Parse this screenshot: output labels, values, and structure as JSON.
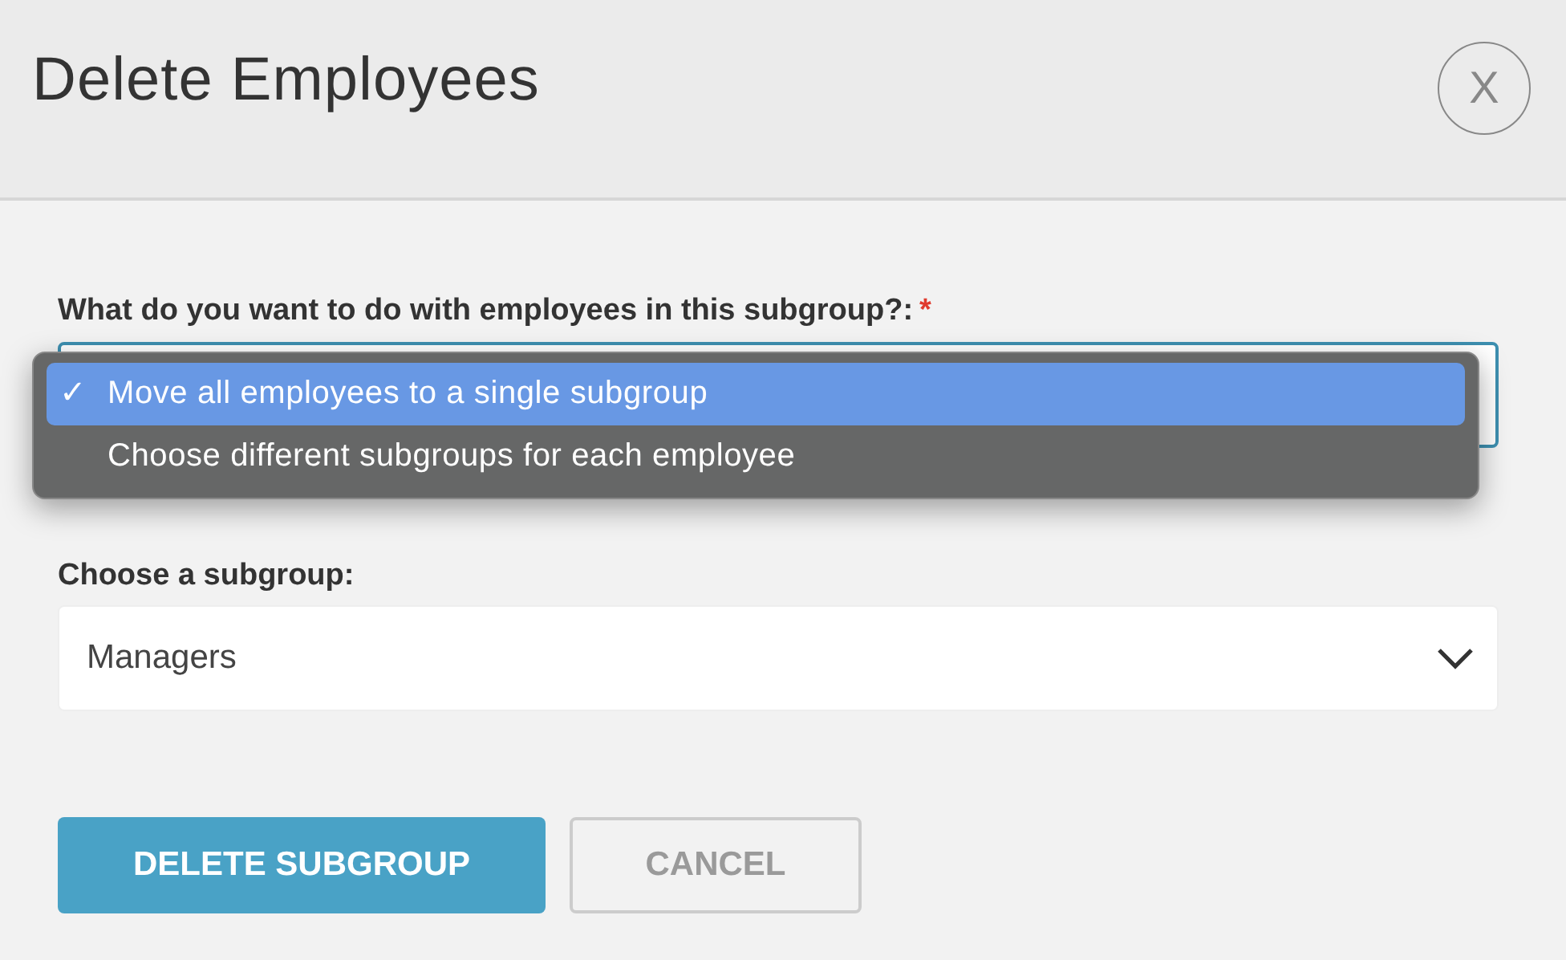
{
  "dialog": {
    "title": "Delete Employees",
    "close_label": "X"
  },
  "fields": [
    {
      "label": "What do you want to do with employees in this subgroup?:",
      "required_mark": "*",
      "open": true,
      "options": [
        {
          "label": "Move all employees to a single subgroup",
          "selected": true,
          "check": "✓"
        },
        {
          "label": "Choose different subgroups for each employee",
          "selected": false
        }
      ]
    },
    {
      "label": "Choose a subgroup:",
      "value": "Managers",
      "open": false
    }
  ],
  "buttons": [
    {
      "label": "DELETE SUBGROUP",
      "kind": "primary"
    },
    {
      "label": "CANCEL",
      "kind": "secondary"
    }
  ]
}
